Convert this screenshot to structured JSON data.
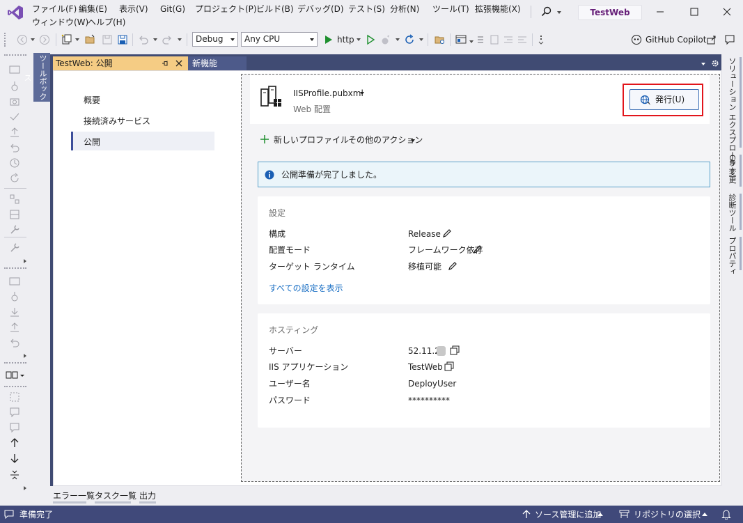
{
  "menu": {
    "row1": [
      "ファイル(F)",
      "編集(E)",
      "表示(V)",
      "Git(G)",
      "プロジェクト(P)",
      "ビルド(B)",
      "デバッグ(D)",
      "テスト(S)",
      "分析(N)",
      "ツール(T)",
      "拡張機能(X)"
    ],
    "row2": [
      "ウィンドウ(W)",
      "ヘルプ(H)"
    ]
  },
  "title": {
    "project": "TestWeb"
  },
  "toolbar": {
    "configuration": "Debug",
    "platform": "Any CPU",
    "run_target": "http",
    "copilot": "GitHub Copilot"
  },
  "left_panel": {
    "toolbox": "ツールボックス"
  },
  "tabs": {
    "active": "TestWeb: 公開",
    "inactive": "新機能"
  },
  "nav": {
    "items": [
      "概要",
      "接続済みサービス",
      "公開"
    ]
  },
  "profile": {
    "name": "IISProfile.pubxml",
    "subtitle": "Web 配置",
    "publish_button": "発行(U)"
  },
  "actions": {
    "new_profile": "新しいプロファイル",
    "other_actions": "その他のアクション"
  },
  "info": {
    "message": "公開準備が完了しました。"
  },
  "settings": {
    "header": "設定",
    "rows": [
      {
        "label": "構成",
        "value": "Release"
      },
      {
        "label": "配置モード",
        "value": "フレームワーク依存"
      },
      {
        "label": "ターゲット ランタイム",
        "value": "移植可能"
      }
    ],
    "show_all": "すべての設定を表示"
  },
  "hosting": {
    "header": "ホスティング",
    "rows": [
      {
        "label": "サーバー",
        "value": "52.11.2."
      },
      {
        "label": "IIS アプリケーション",
        "value": "TestWeb"
      },
      {
        "label": "ユーザー名",
        "value": "DeployUser"
      },
      {
        "label": "パスワード",
        "value": "**********"
      }
    ]
  },
  "right_tabs": [
    "ソリューション エクスプローラー",
    "Git 変更",
    "診断ツール",
    "プロパティ"
  ],
  "bottom_tabs": [
    "エラー一覧",
    "タスク一覧",
    "出力"
  ],
  "status": {
    "ready": "準備完了",
    "source_control": "ソース管理に追加",
    "repository": "リポジトリの選択"
  },
  "colors": {
    "accent": "#68217a",
    "status_bar": "#40497a",
    "highlight": "#e2151b",
    "tab_active": "#f5cc84"
  }
}
